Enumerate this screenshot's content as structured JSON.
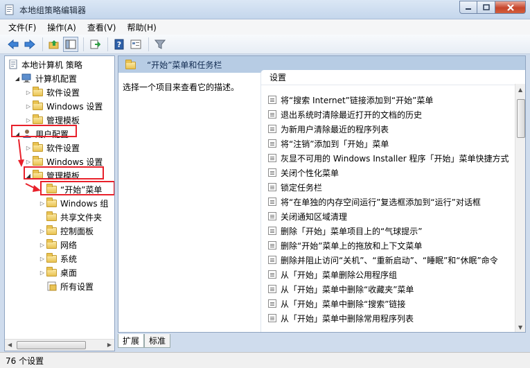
{
  "window": {
    "title": "本地组策略编辑器"
  },
  "menu": [
    "文件(F)",
    "操作(A)",
    "查看(V)",
    "帮助(H)"
  ],
  "toolbar": [
    "back-icon",
    "forward-icon",
    "up-folder-icon",
    "show-hide-tree-icon",
    "export-list-icon",
    "help-icon",
    "properties-icon",
    "filter-icon"
  ],
  "tree": [
    {
      "label": "本地计算机 策略",
      "icon": "policy-icon"
    },
    {
      "label": "计算机配置",
      "icon": "computer-icon"
    },
    {
      "label": "软件设置",
      "icon": "folder-icon"
    },
    {
      "label": "Windows 设置",
      "icon": "folder-icon"
    },
    {
      "label": "管理模板",
      "icon": "folder-icon"
    },
    {
      "label": "用户配置",
      "icon": "user-icon"
    },
    {
      "label": "软件设置",
      "icon": "folder-icon"
    },
    {
      "label": "Windows 设置",
      "icon": "folder-icon"
    },
    {
      "label": "管理模板",
      "icon": "folder-icon"
    },
    {
      "label": "“开始”菜单",
      "icon": "folder-icon"
    },
    {
      "label": "Windows 组",
      "icon": "folder-icon"
    },
    {
      "label": "共享文件夹",
      "icon": "folder-icon"
    },
    {
      "label": "控制面板",
      "icon": "folder-icon"
    },
    {
      "label": "网络",
      "icon": "folder-icon"
    },
    {
      "label": "系统",
      "icon": "folder-icon"
    },
    {
      "label": "桌面",
      "icon": "folder-icon"
    },
    {
      "label": "所有设置",
      "icon": "folder-icon"
    }
  ],
  "detail": {
    "header_title": "“开始”菜单和任务栏",
    "description": "选择一个项目来查看它的描述。",
    "column_header": "设置",
    "items": [
      "将“搜索 Internet”链接添加到“开始”菜单",
      "退出系统时清除最近打开的文档的历史",
      "为新用户清除最近的程序列表",
      "将“注销”添加到「开始」菜单",
      "灰显不可用的 Windows Installer 程序「开始」菜单快捷方式",
      "关闭个性化菜单",
      "锁定任务栏",
      "将“在单独的内存空间运行”复选框添加到“运行”对话框",
      "关闭通知区域清理",
      "删除「开始」菜单项目上的“气球提示”",
      "删除“开始”菜单上的拖放和上下文菜单",
      "删除并阻止访问“关机”、“重新启动”、“睡眠”和“休眠”命令",
      "从「开始」菜单删除公用程序组",
      "从「开始」菜单中删除“收藏夹”菜单",
      "从「开始」菜单中删除“搜索”链接",
      "从「开始」菜单中删除常用程序列表"
    ]
  },
  "tabs": [
    "扩展",
    "标准"
  ],
  "status": "76 个设置",
  "colors": {
    "highlight_box": "#e8202a",
    "detail_header_bg": "#b7cce4"
  }
}
